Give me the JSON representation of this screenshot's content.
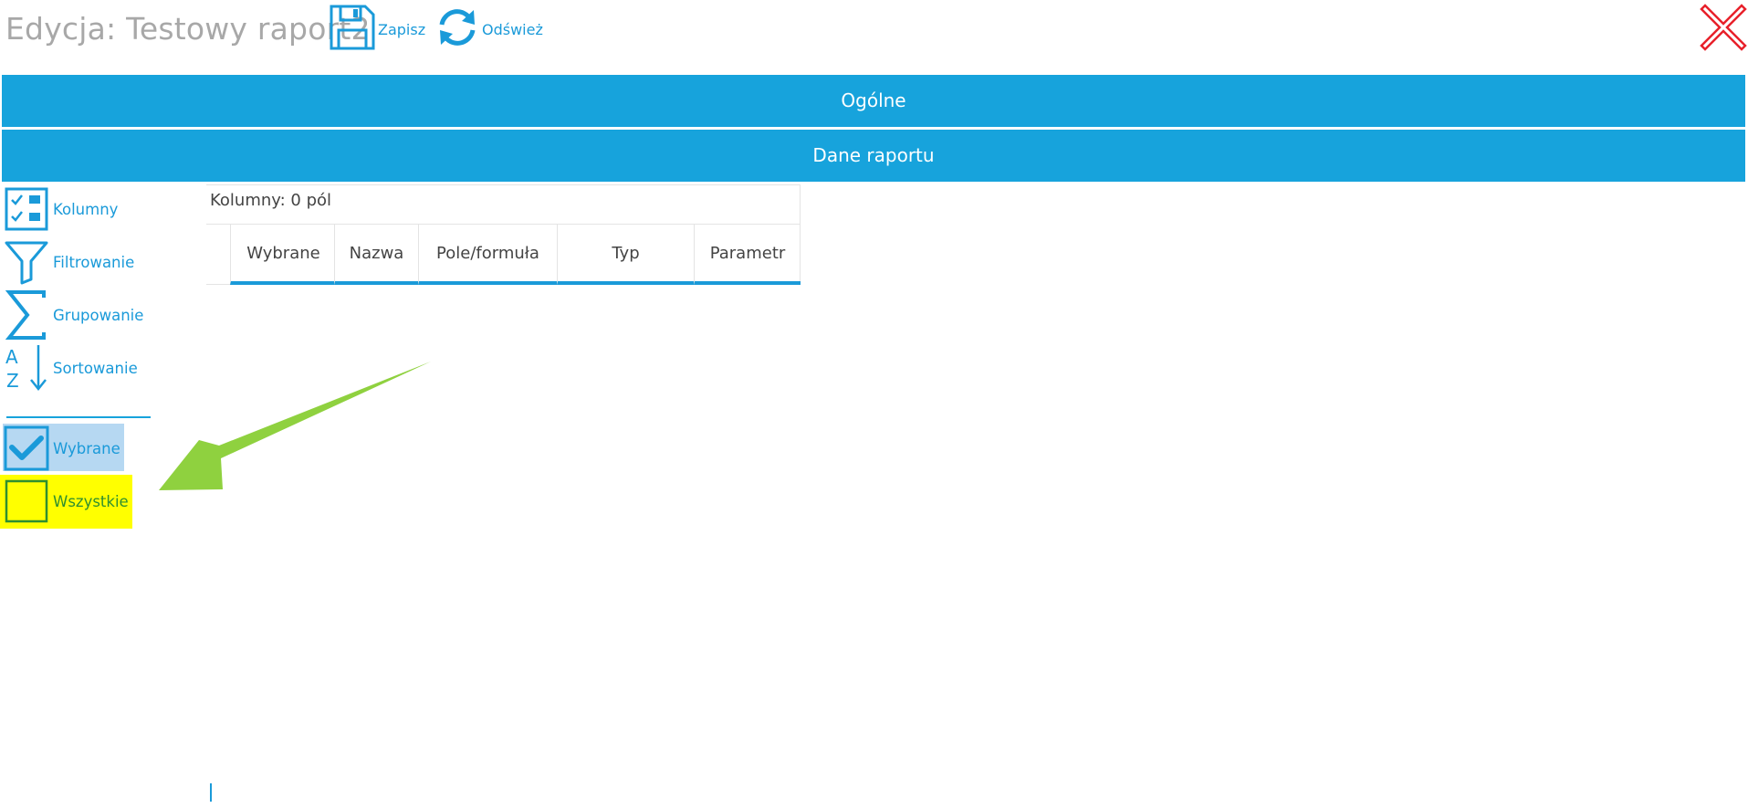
{
  "window": {
    "title": "Edycja: Testowy raport2",
    "save_label": "Zapisz",
    "refresh_label": "Odśwież",
    "save_icon": "floppy-disk-icon",
    "refresh_icon": "refresh-icon",
    "close_icon": "close-icon"
  },
  "sections": {
    "general": "Ogólne",
    "report_data": "Dane raportu"
  },
  "sidebar": {
    "items": [
      {
        "label": "Kolumny",
        "icon": "columns-icon"
      },
      {
        "label": "Filtrowanie",
        "icon": "filter-icon"
      },
      {
        "label": "Grupowanie",
        "icon": "sigma-icon"
      },
      {
        "label": "Sortowanie",
        "icon": "sort-az-icon"
      }
    ],
    "toggles": [
      {
        "label": "Wybrane",
        "icon": "checked-checkbox-icon",
        "selected": true
      },
      {
        "label": "Wszystkie",
        "icon": "empty-checkbox-icon",
        "highlighted": true
      }
    ]
  },
  "columns_panel": {
    "caption": "Kolumny: 0 pól",
    "headers": [
      "Wybrane",
      "Nazwa",
      "Pole/formuła",
      "Typ",
      "Parametr"
    ],
    "rows": []
  },
  "annotation": {
    "arrow_icon": "green-arrow-icon",
    "arrow_color": "#8fd13f",
    "highlight_color": "#ffff00"
  },
  "colors": {
    "accent": "#17a3dc",
    "link": "#1a9ad9",
    "close": "#e8202a",
    "title": "#a8a8a8",
    "selection": "#b6d8f2"
  }
}
